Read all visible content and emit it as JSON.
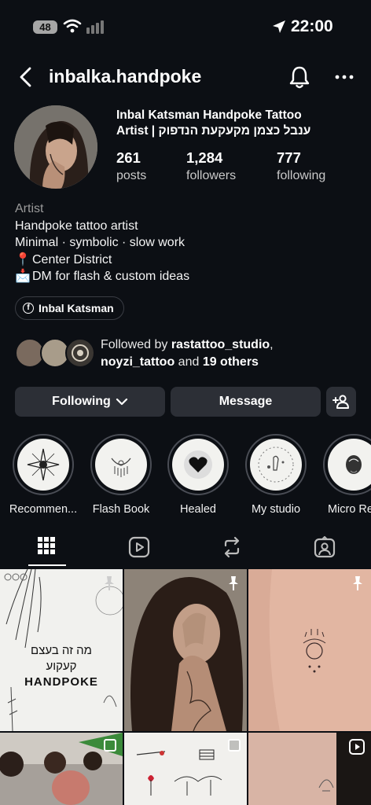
{
  "status": {
    "battery": "48",
    "time": "22:00"
  },
  "nav": {
    "username": "inbalka.handpoke"
  },
  "profile": {
    "display_name_line1": "Inbal Katsman Handpoke Tattoo",
    "display_name_line2": "Artist | ענבל כצמן מקעקעת הנדפוק",
    "stats": [
      {
        "value": "261",
        "label": "posts"
      },
      {
        "value": "1,284",
        "label": "followers"
      },
      {
        "value": "777",
        "label": "following"
      }
    ],
    "bio": {
      "category": "Artist",
      "lines": [
        "Handpoke tattoo artist",
        "Minimal · symbolic · slow work"
      ],
      "location_emoji": "📍",
      "location": "Center District",
      "dm_emoji": "📩",
      "dm": "DM for flash & custom ideas"
    },
    "facebook_link": "Inbal Katsman",
    "mutual": {
      "prefix": "Followed by ",
      "first": "rastattoo_studio",
      "comma": ",",
      "second": "noyzi_tattoo",
      "middle": " and ",
      "others": "19 others"
    }
  },
  "actions": {
    "following": "Following",
    "message": "Message"
  },
  "highlights": [
    {
      "label": "Recommen..."
    },
    {
      "label": "Flash Book"
    },
    {
      "label": "Healed"
    },
    {
      "label": "My studio"
    },
    {
      "label": "Micro Rea"
    }
  ],
  "tabs": [
    "grid",
    "reels",
    "reposts",
    "tagged"
  ],
  "posts": {
    "post1_text": [
      "מה זה בעצם",
      "קעקוע",
      "HANDPOKE"
    ]
  },
  "colors": {
    "background": "#0c0f14",
    "button": "#2c2f36",
    "accent_white": "#ffffff"
  }
}
